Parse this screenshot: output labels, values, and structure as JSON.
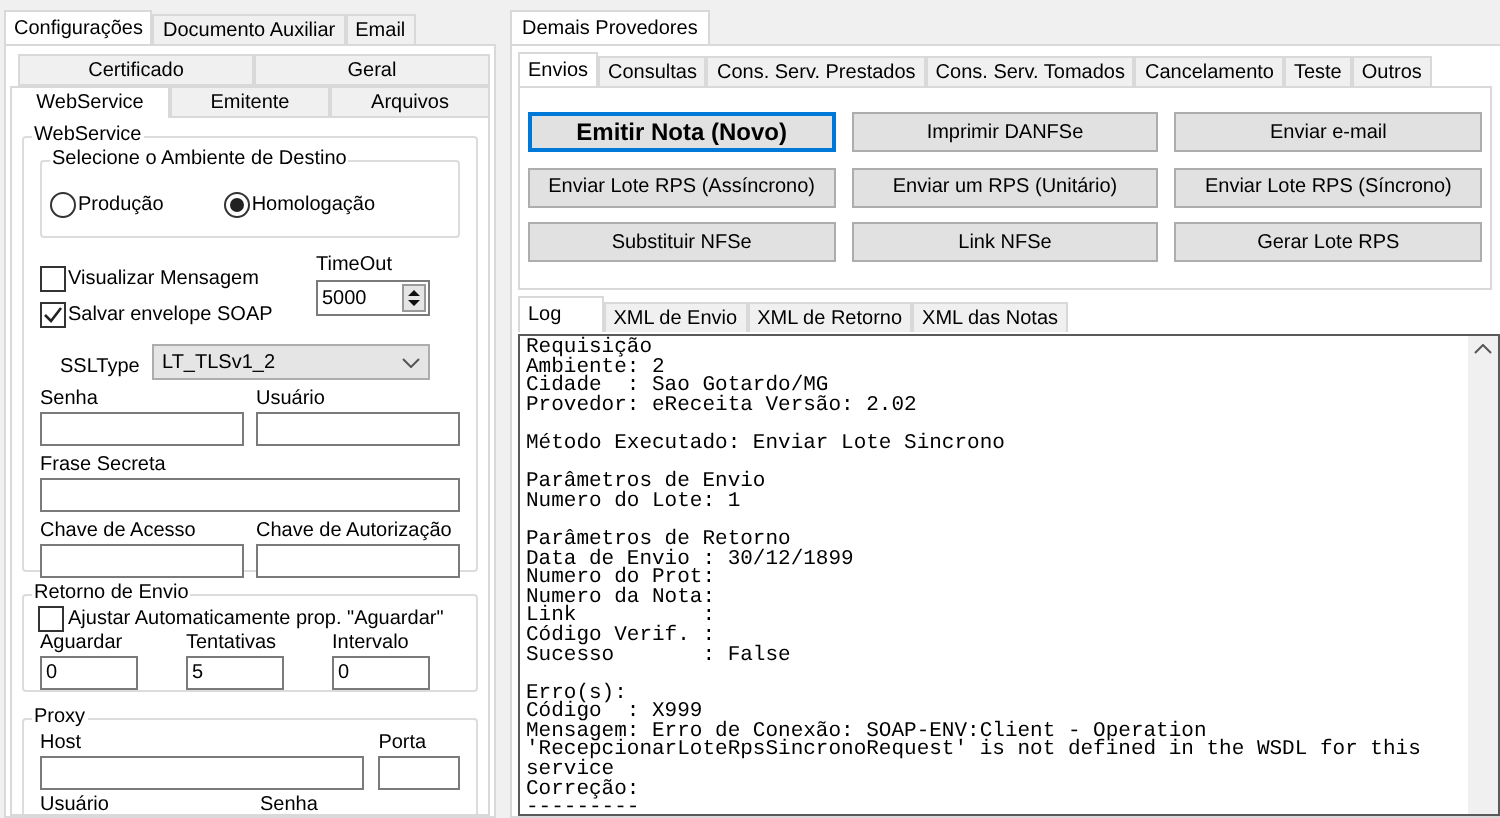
{
  "left_panel": {
    "tabs": [
      {
        "label": "Configurações",
        "selected": true
      },
      {
        "label": "Documento Auxiliar",
        "selected": false
      },
      {
        "label": "Email",
        "selected": false
      }
    ],
    "sub_tab_rows": [
      [
        {
          "label": "Certificado",
          "selected": false
        },
        {
          "label": "Geral",
          "selected": false
        }
      ],
      [
        {
          "label": "WebService",
          "selected": true
        },
        {
          "label": "Emitente",
          "selected": false
        },
        {
          "label": "Arquivos",
          "selected": false
        }
      ]
    ],
    "webservice_group": {
      "title": "WebService",
      "environment_group": {
        "title": "Selecione o Ambiente de Destino",
        "options": [
          {
            "label": "Produção",
            "selected": false
          },
          {
            "label": "Homologação",
            "selected": true
          }
        ]
      },
      "checkboxes": [
        {
          "label": "Visualizar Mensagem",
          "checked": false
        },
        {
          "label": "Salvar envelope SOAP",
          "checked": true
        }
      ],
      "timeout": {
        "label": "TimeOut",
        "value": "5000"
      },
      "ssl_type": {
        "label": "SSLType",
        "value": "LT_TLSv1_2"
      },
      "field_rows": [
        [
          {
            "label": "Senha"
          },
          {
            "label": "Usuário"
          }
        ],
        [
          {
            "label": "Frase Secreta"
          }
        ],
        [
          {
            "label": "Chave de Acesso"
          },
          {
            "label": "Chave de Autorização"
          }
        ]
      ]
    },
    "return_group": {
      "title": "Retorno de Envio",
      "checkbox": {
        "label": "Ajustar Automaticamente prop. \"Aguardar\"",
        "checked": false
      },
      "fields": [
        {
          "label": "Aguardar",
          "value": "0"
        },
        {
          "label": "Tentativas",
          "value": "5"
        },
        {
          "label": "Intervalo",
          "value": "0"
        }
      ]
    },
    "proxy_group": {
      "title": "Proxy",
      "fields": [
        {
          "label": "Host"
        },
        {
          "label": "Porta"
        }
      ],
      "cut_labels": [
        "Usuário",
        "Senha"
      ]
    }
  },
  "right_panel": {
    "tabs": [
      {
        "label": "Demais Provedores",
        "selected": true
      }
    ],
    "action_tabs": [
      {
        "label": "Envios",
        "selected": true
      },
      {
        "label": "Consultas",
        "selected": false
      },
      {
        "label": "Cons. Serv. Prestados",
        "selected": false
      },
      {
        "label": "Cons. Serv. Tomados",
        "selected": false
      },
      {
        "label": "Cancelamento",
        "selected": false
      },
      {
        "label": "Teste",
        "selected": false
      },
      {
        "label": "Outros",
        "selected": false
      }
    ],
    "buttons": [
      {
        "label": "Emitir Nota (Novo)",
        "focused": true
      },
      {
        "label": "Imprimir DANFSe",
        "focused": false
      },
      {
        "label": "Enviar e-mail",
        "focused": false
      },
      {
        "label": "Enviar Lote RPS (Assíncrono)",
        "focused": false
      },
      {
        "label": "Enviar um RPS (Unitário)",
        "focused": false
      },
      {
        "label": "Enviar Lote RPS (Síncrono)",
        "focused": false
      },
      {
        "label": "Substituir NFSe",
        "focused": false
      },
      {
        "label": "Link NFSe",
        "focused": false
      },
      {
        "label": "Gerar Lote RPS",
        "focused": false
      }
    ],
    "log_tabs": [
      {
        "label": "Log",
        "selected": true
      },
      {
        "label": "XML de Envio",
        "selected": false
      },
      {
        "label": "XML de Retorno",
        "selected": false
      },
      {
        "label": "XML das Notas",
        "selected": false
      }
    ],
    "log_blocks": [
      [
        "Requisição",
        "Ambiente: 2",
        "Cidade  : Sao Gotardo/MG",
        "Provedor: eReceita Versão: 2.02"
      ],
      [
        "Método Executado: Enviar Lote Sincrono"
      ],
      [
        "Parâmetros de Envio",
        "Numero do Lote: 1"
      ],
      [
        "Parâmetros de Retorno",
        "Data de Envio : 30/12/1899",
        "Numero do Prot:",
        "Numero da Nota:",
        "Link          :",
        "Código Verif. :",
        "Sucesso       : False"
      ],
      [
        "Erro(s):",
        "Código  : X999",
        "Mensagem: Erro de Conexão: SOAP-ENV:Client - Operation",
        "'RecepcionarLoteRpsSincronoRequest' is not defined in the WSDL for this",
        "service",
        "Correção:",
        "---------"
      ]
    ]
  }
}
